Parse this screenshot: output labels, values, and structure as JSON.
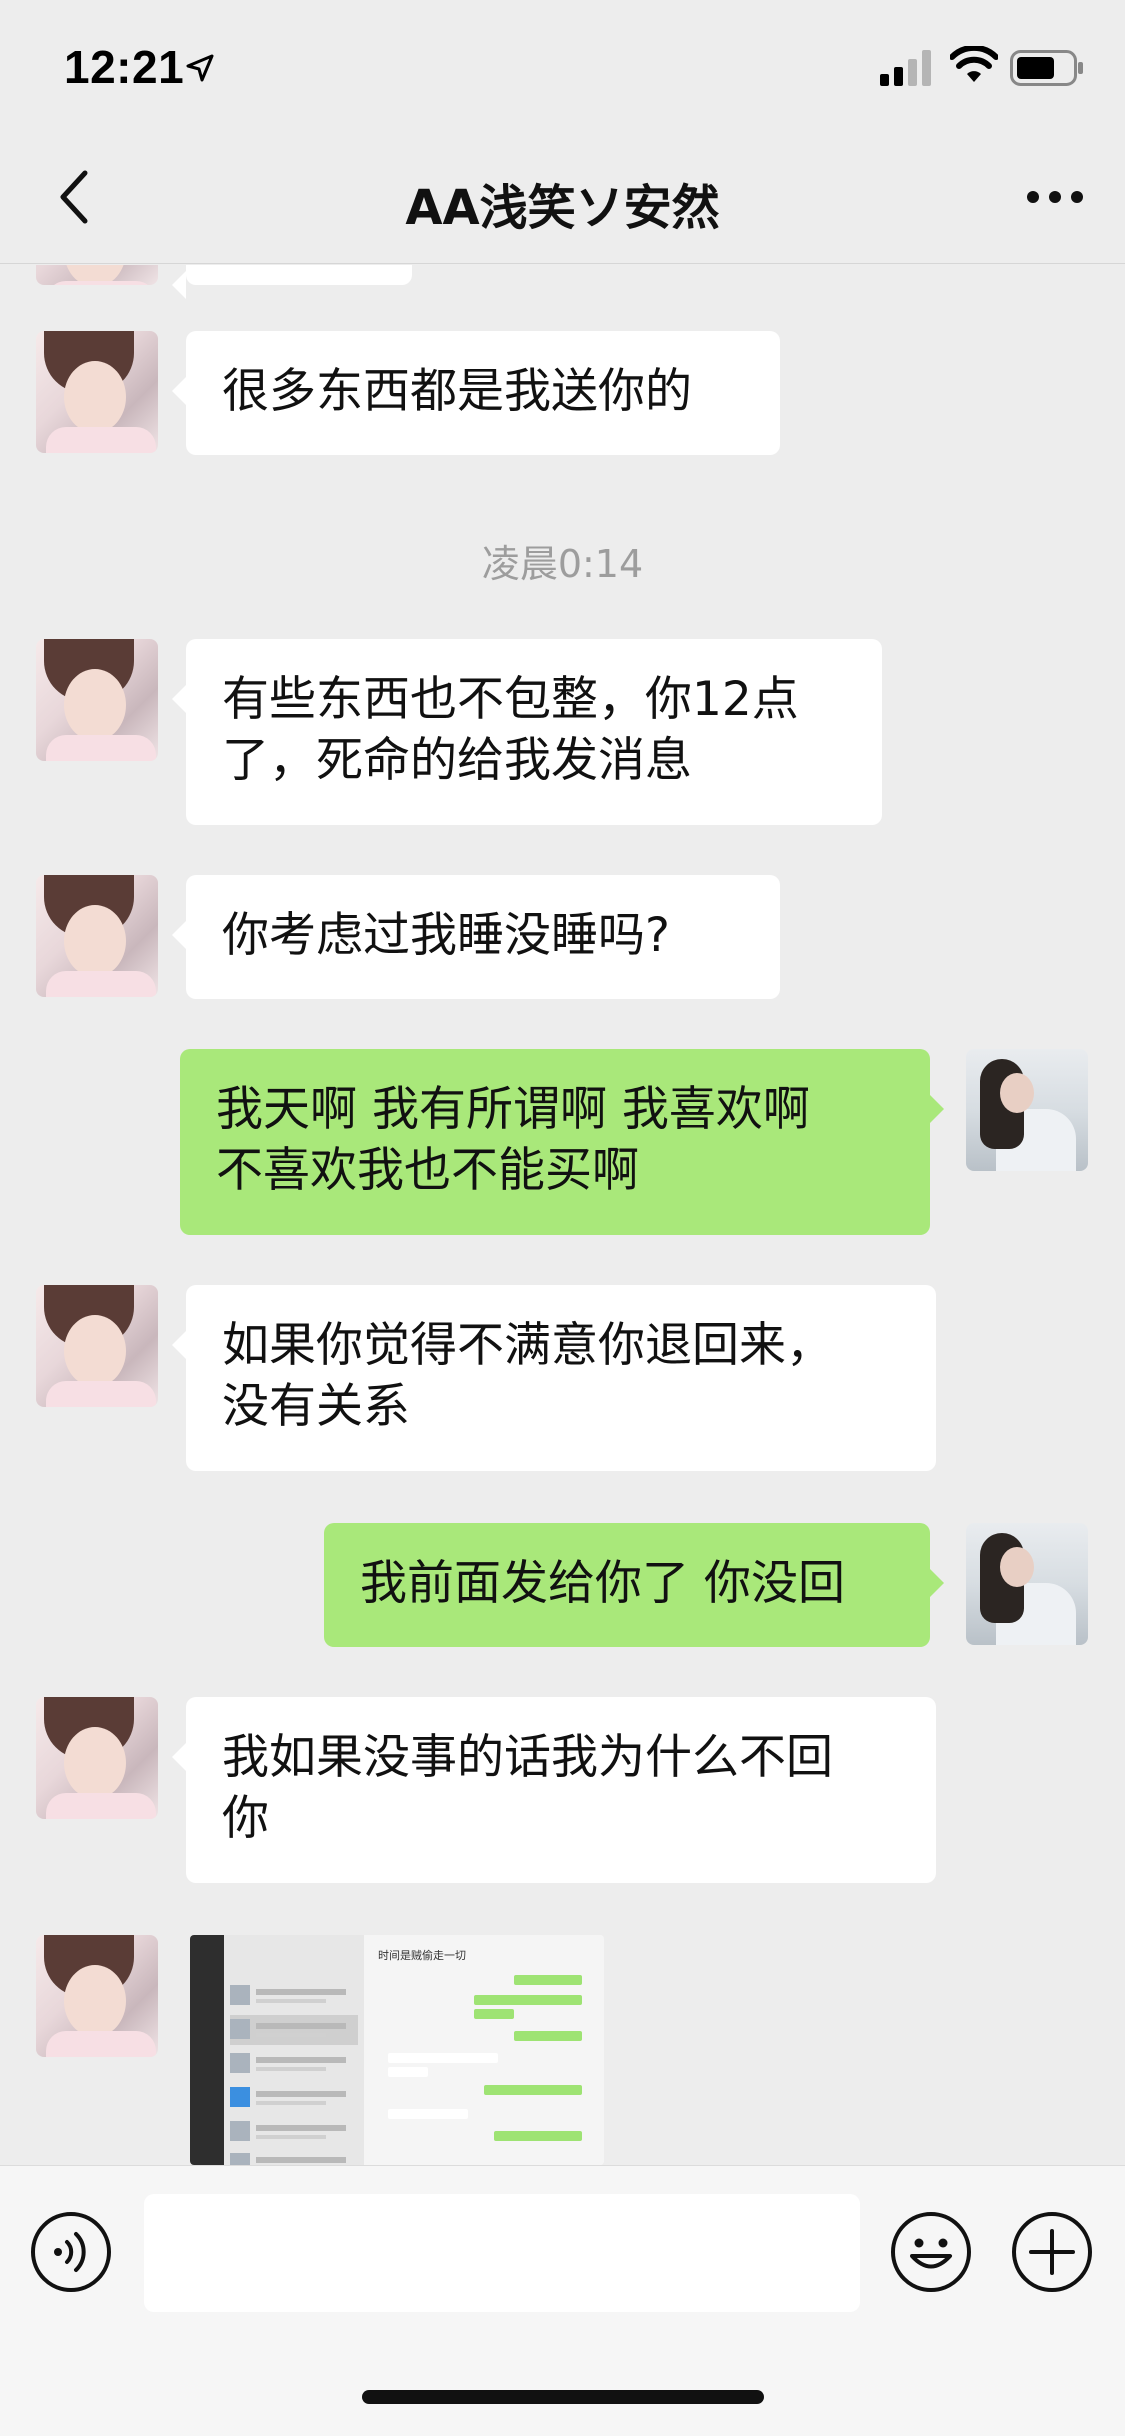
{
  "status_bar": {
    "time": "12:21"
  },
  "nav": {
    "title": "AA浅笑ソ安然"
  },
  "messages": [
    {
      "side": "left",
      "text": "很多东西都是我送你的"
    },
    {
      "type": "time",
      "text": "凌晨0:14"
    },
    {
      "side": "left",
      "lines": [
        "有些东西也不包整，你12点",
        "了，死命的给我发消息"
      ]
    },
    {
      "side": "left",
      "text": "你考虑过我睡没睡吗?"
    },
    {
      "side": "right",
      "lines": [
        "我天啊 我有所谓啊  我喜欢啊",
        "不喜欢我也不能买啊"
      ]
    },
    {
      "side": "left",
      "lines": [
        "如果你觉得不满意你退回来，",
        "没有关系"
      ]
    },
    {
      "side": "right",
      "text": "我前面发给你了 你没回"
    },
    {
      "side": "left",
      "lines": [
        "我如果没事的话我为什么不回",
        "你"
      ]
    },
    {
      "side": "left",
      "type": "image"
    }
  ],
  "thumbnail": {
    "chat_title": "时间是贼偷走一切",
    "list_items": [
      "99届高庄小学",
      "时间是贼偷走一切",
      "助燃法师俱乐部交流群",
      "订阅号",
      "MARCH 女装",
      "你们闪睡啦!"
    ]
  },
  "colors": {
    "background": "#ededed",
    "bubble_sent": "#a9e87a",
    "bubble_received": "#ffffff",
    "timestamp": "#9d9d9d"
  },
  "icons": [
    "back-chevron-icon",
    "more-dots-icon",
    "voice-icon",
    "emoji-icon",
    "plus-icon",
    "location-arrow-icon",
    "signal-icon",
    "wifi-icon",
    "battery-icon"
  ]
}
